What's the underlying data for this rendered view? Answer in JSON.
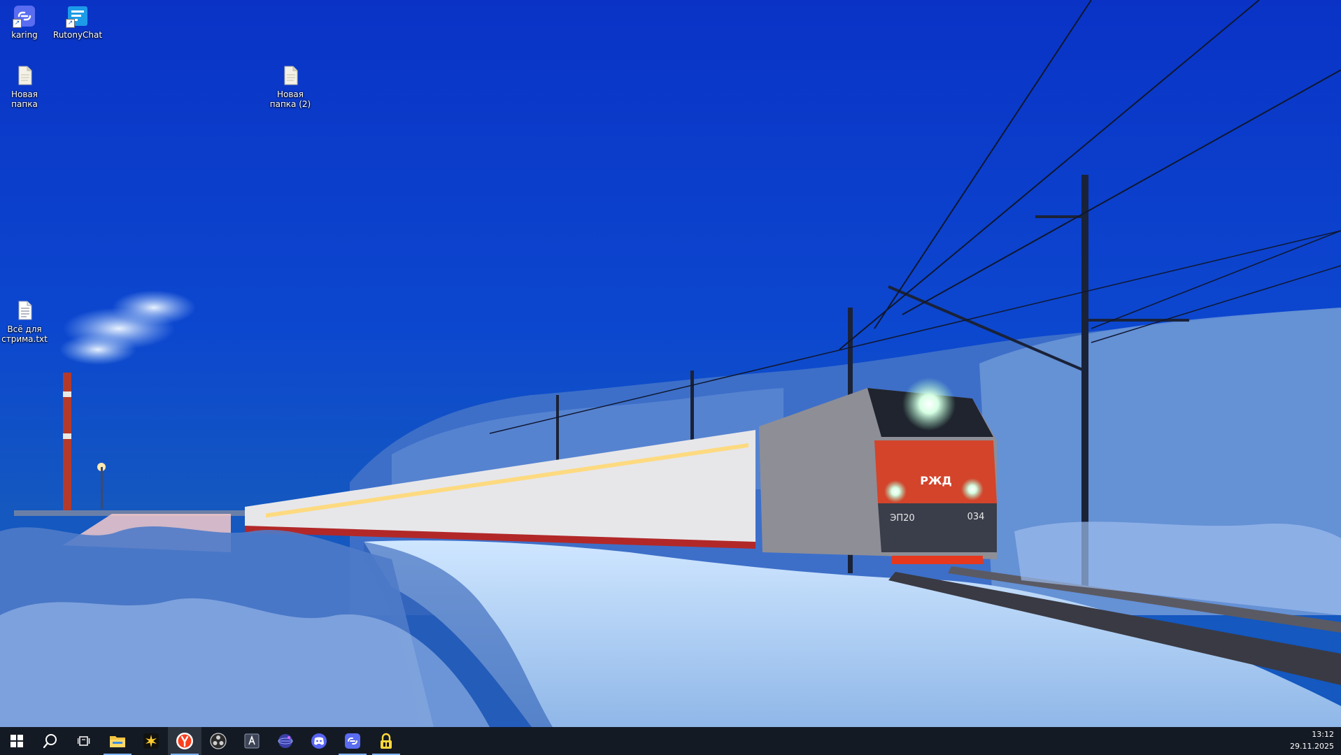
{
  "desktop": {
    "icons": [
      {
        "label": "karing",
        "icon": "karing-app-icon"
      },
      {
        "label": "RutonyChat",
        "icon": "rutonychat-app-icon"
      },
      {
        "label": "Новая папка",
        "icon": "folder-file-icon"
      },
      {
        "label": "Новая папка (2)",
        "icon": "folder-file-icon"
      },
      {
        "label": "Всё для стрима.txt",
        "icon": "text-file-icon"
      }
    ],
    "wallpaper": {
      "locomotive_number_left": "ЭП20",
      "locomotive_number_right": "034",
      "locomotive_logo": "РЖД"
    }
  },
  "taskbar": {
    "buttons": [
      {
        "name": "start-button",
        "icon": "windows-logo-icon"
      },
      {
        "name": "search-button",
        "icon": "search-icon"
      },
      {
        "name": "task-view-button",
        "icon": "task-view-icon"
      },
      {
        "name": "file-explorer-button",
        "icon": "folder-icon",
        "running": true
      },
      {
        "name": "app-star-button",
        "icon": "star-burst-icon"
      },
      {
        "name": "yandex-browser-button",
        "icon": "yandex-browser-icon",
        "running": true,
        "active": true
      },
      {
        "name": "obs-button",
        "icon": "obs-icon"
      },
      {
        "name": "app-a-button",
        "icon": "letter-a-icon"
      },
      {
        "name": "app-globe-button",
        "icon": "globe-icon"
      },
      {
        "name": "discord-button",
        "icon": "discord-icon"
      },
      {
        "name": "karing-button",
        "icon": "karing-app-icon",
        "running": true
      },
      {
        "name": "vpn-lock-button",
        "icon": "lock-icon",
        "running": true
      }
    ],
    "clock": {
      "time": "13:12",
      "date": "29.11.2025"
    }
  },
  "colors": {
    "sky_top": "#0a35c8",
    "taskbar": "#141a24",
    "running_underline": "#7fb3f5"
  }
}
